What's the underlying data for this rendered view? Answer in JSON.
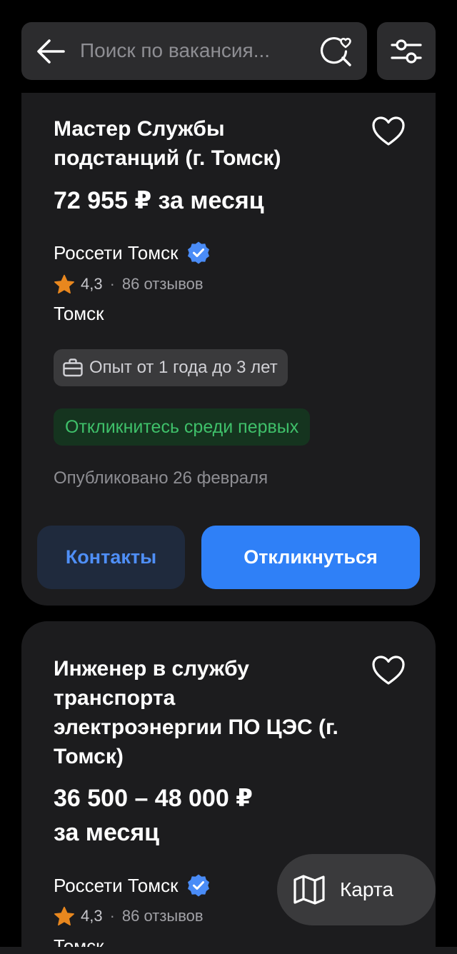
{
  "search": {
    "placeholder": "Поиск по вакансия..."
  },
  "colors": {
    "background": "#000000",
    "card": "#1c1c1e",
    "accent_blue": "#2f80f7",
    "verified_blue": "#4a8cf7",
    "star_orange": "#e8871e",
    "success_green": "#3fc06a"
  },
  "icons": {
    "back": "arrow-left-icon",
    "saved_search": "search-heart-icon",
    "filter": "sliders-icon",
    "favorite": "heart-outline-icon",
    "verified": "verified-badge-icon",
    "star": "star-icon",
    "briefcase": "briefcase-icon",
    "map": "map-icon"
  },
  "vacancies": [
    {
      "title": "Мастер Службы подстанций (г. Томск)",
      "salary": "72 955 ₽ за месяц",
      "company": "Россети Томск",
      "rating": "4,3",
      "reviews": "86 отзывов",
      "city": "Томск",
      "experience": "Опыт от 1 года до 3 лет",
      "early_badge": "Откликнитесь среди первых",
      "published": "Опубликовано 26 февраля",
      "contacts_label": "Контакты",
      "respond_label": "Откликнуться"
    },
    {
      "title": "Инженер в службу транспорта электроэнергии ПО ЦЭС (г. Томск)",
      "salary_line1": "36 500 – 48 000 ₽",
      "salary_line2": "за месяц",
      "company": "Россети Томск",
      "rating": "4,3",
      "reviews": "86 отзывов",
      "city": "Томск"
    }
  ],
  "map_button": {
    "label": "Карта"
  }
}
